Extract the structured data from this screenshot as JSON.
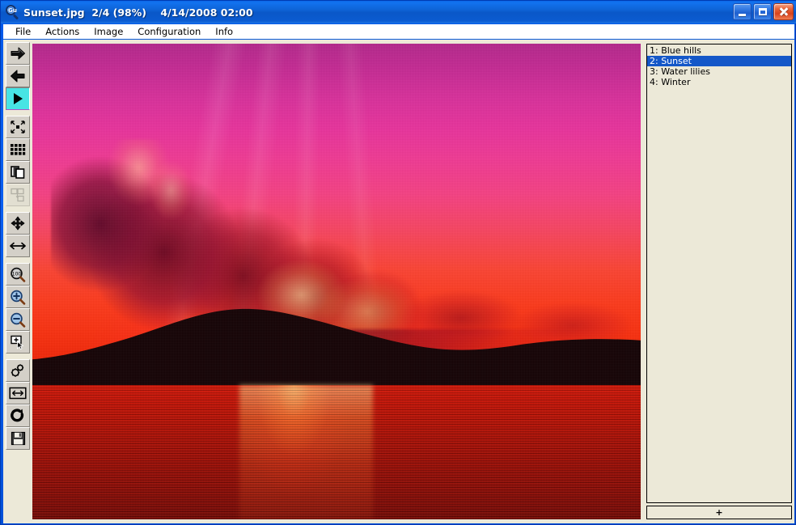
{
  "window": {
    "title": "Sunset.jpg  2/4 (98%)    4/14/2008 02:00",
    "app_icon": "magnifier-icon",
    "icon_label": "Gu",
    "controls": {
      "minimize": "minimize-button",
      "maximize": "maximize-button",
      "close": "close-button"
    },
    "frame_color": "#0a5ff0",
    "titlebar_text_color": "#ffffff"
  },
  "menubar": {
    "items": [
      {
        "label": "File"
      },
      {
        "label": "Actions"
      },
      {
        "label": "Image"
      },
      {
        "label": "Configuration"
      },
      {
        "label": "Info"
      }
    ]
  },
  "toolbar": {
    "buttons": [
      {
        "name": "next-image-button",
        "icon": "arrow-right-icon",
        "state": "enabled"
      },
      {
        "name": "previous-image-button",
        "icon": "arrow-left-icon",
        "state": "enabled"
      },
      {
        "name": "slideshow-play-button",
        "icon": "play-triangle-icon",
        "state": "active"
      },
      {
        "name": "fit-to-window-button",
        "icon": "fit-expand-icon",
        "state": "enabled"
      },
      {
        "name": "thumbnails-button",
        "icon": "grid-thumbnails-icon",
        "state": "enabled"
      },
      {
        "name": "copy-image-button",
        "icon": "copy-pages-icon",
        "state": "enabled"
      },
      {
        "name": "paste-image-button",
        "icon": "paste-into-icon",
        "state": "disabled"
      },
      {
        "name": "pan-move-button",
        "icon": "four-way-arrow-icon",
        "state": "enabled"
      },
      {
        "name": "fit-width-button",
        "icon": "horizontal-arrow-icon",
        "state": "enabled"
      },
      {
        "name": "zoom-100-button",
        "icon": "magnifier-100-icon",
        "state": "enabled"
      },
      {
        "name": "zoom-in-button",
        "icon": "magnifier-plus-icon",
        "state": "enabled"
      },
      {
        "name": "zoom-out-button",
        "icon": "magnifier-minus-icon",
        "state": "enabled"
      },
      {
        "name": "select-region-button",
        "icon": "marquee-cursor-icon",
        "state": "enabled"
      },
      {
        "name": "settings-button",
        "icon": "gears-icon",
        "state": "enabled"
      },
      {
        "name": "resize-image-button",
        "icon": "resize-width-icon",
        "state": "enabled"
      },
      {
        "name": "rotate-button",
        "icon": "rotate-cw-icon",
        "state": "enabled"
      },
      {
        "name": "save-button",
        "icon": "floppy-disk-icon",
        "state": "enabled"
      }
    ]
  },
  "image_view": {
    "name": "sunset-photograph",
    "description": "Sunset over water with dark hills and magenta-to-red sky",
    "zoom_percent": "98%",
    "index": "2/4"
  },
  "file_list": {
    "items": [
      {
        "label": "1: Blue hills",
        "selected": false
      },
      {
        "label": "2: Sunset",
        "selected": true
      },
      {
        "label": "3: Water lilies",
        "selected": false
      },
      {
        "label": "4: Winter",
        "selected": false
      }
    ],
    "add_button_label": "+",
    "selection_color": "#1457c8",
    "background_color": "#ece9d8"
  }
}
